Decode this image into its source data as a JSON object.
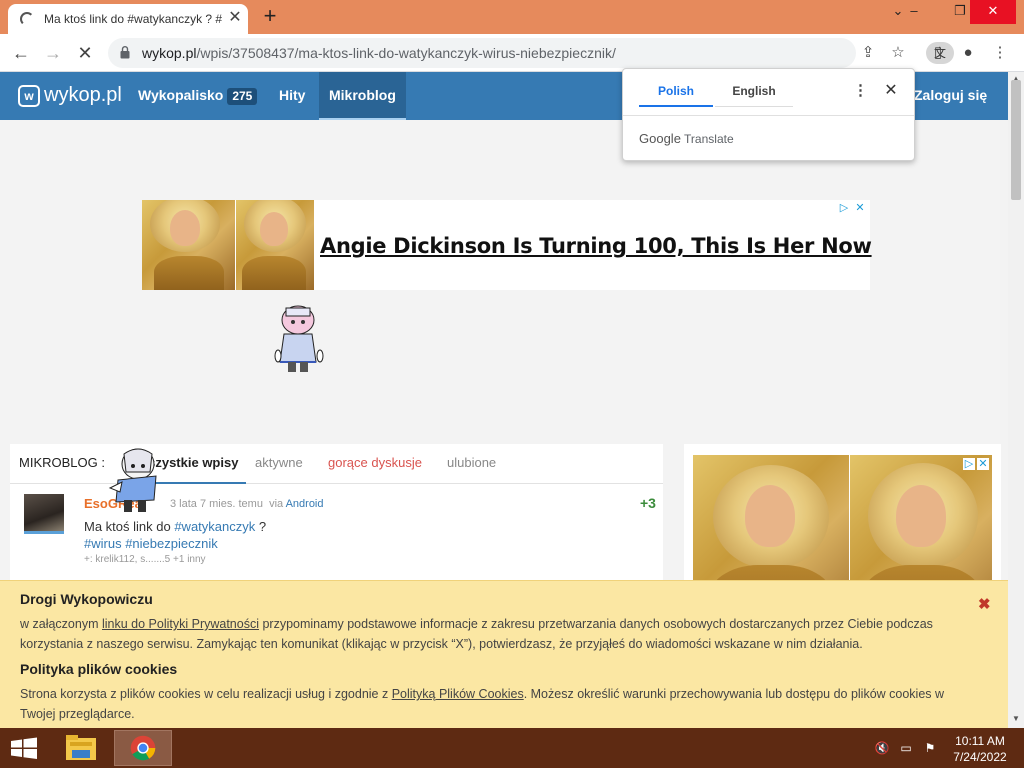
{
  "browser": {
    "tab_title": "Ma ktoś link do #watykanczyk ? #",
    "url_host": "wykop.pl",
    "url_path": "/wpis/37508437/ma-ktos-link-do-watykanczyk-wirus-niebezpiecznik/"
  },
  "site_nav": {
    "logo": "wykop.pl",
    "wykopalisko_label": "Wykopalisko",
    "wykopalisko_count": "275",
    "hity_label": "Hity",
    "mikroblog_label": "Mikroblog",
    "login_label": "Zaloguj się"
  },
  "translate_popup": {
    "source_lang": "Polish",
    "target_lang": "English",
    "brand_google": "Google",
    "brand_translate": "Translate"
  },
  "ad_top": {
    "headline": "Angie Dickinson Is Turning 100, This Is Her Now"
  },
  "microblog": {
    "label": "MIKROBLOG :",
    "tab_all": "wszystkie wpisy",
    "tab_active": "aktywne",
    "tab_hot": "gorące dyskusje",
    "tab_favorites": "ulubione"
  },
  "entry": {
    "author": "EsoGReal",
    "time": "3 lata 7 mies. temu",
    "via_label": "via",
    "via_app": "Android",
    "votes": "+3",
    "text_prefix": "Ma ktoś link do ",
    "tag_1": "#watykanczyk",
    "text_suffix": " ?",
    "tag_2": "#wirus",
    "tag_3": "#niebezpiecznik",
    "plusers": "+: krelik112, s.......5 +1 inny"
  },
  "cookie_banner": {
    "heading_1": "Drogi Wykopowiczu",
    "para_1_a": "w załączonym ",
    "para_1_link": "linku do Polityki Prywatności",
    "para_1_b": " przypominamy podstawowe informacje z zakresu przetwarzania danych osobowych dostarczanych przez Ciebie podczas korzystania z naszego serwisu. Zamykając ten komunikat (klikając w przycisk “X”), potwierdzasz, że przyjąłeś do wiadomości wskazane w nim działania.",
    "heading_2": "Polityka plików cookies",
    "para_2_a": "Strona korzysta z plików cookies w celu realizacji usług i zgodnie z ",
    "para_2_link": "Polityką Plików Cookies",
    "para_2_b": ". Możesz określić warunki przechowywania lub dostępu do plików cookies w Twojej przeglądarce."
  },
  "taskbar": {
    "time": "10:11 AM",
    "date": "7/24/2022"
  },
  "colors": {
    "tabbar": "#e68a5c",
    "site_nav": "#367ab3",
    "cookie_bg": "#fbe7a3",
    "taskbar": "#5e2a12"
  }
}
